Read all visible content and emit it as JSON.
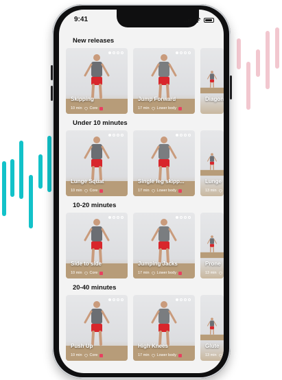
{
  "status": {
    "time": "9:41"
  },
  "colors": {
    "accent_left": "#12c2c9",
    "accent_right": "#f2c7cf",
    "level": "#e84060"
  },
  "sections": [
    {
      "title": "New releases",
      "cards": [
        {
          "name": "Skipping",
          "duration": "10 min",
          "focus": "Core",
          "dots": 4
        },
        {
          "name": "Jump Forward",
          "duration": "17 min",
          "focus": "Lower body",
          "dots": 4
        },
        {
          "name": "Diagon",
          "duration": "",
          "focus": "",
          "dots": 0
        }
      ]
    },
    {
      "title": "Under 10 minutes",
      "cards": [
        {
          "name": "Lunge Squat",
          "duration": "10 min",
          "focus": "Core",
          "dots": 4
        },
        {
          "name": "Single leg skipp...",
          "duration": "17 min",
          "focus": "Lower body",
          "dots": 4
        },
        {
          "name": "Lunge",
          "duration": "13 min",
          "focus": "",
          "dots": 0
        }
      ]
    },
    {
      "title": "10-20 minutes",
      "cards": [
        {
          "name": "Side to side",
          "duration": "10 min",
          "focus": "Core",
          "dots": 4
        },
        {
          "name": "Jumping Jacks",
          "duration": "17 min",
          "focus": "Lower body",
          "dots": 4
        },
        {
          "name": "Prone",
          "duration": "13 min",
          "focus": "",
          "dots": 0
        }
      ]
    },
    {
      "title": "20-40 minutes",
      "cards": [
        {
          "name": "Push Up",
          "duration": "10 min",
          "focus": "Core",
          "dots": 4
        },
        {
          "name": "High Knees",
          "duration": "17 min",
          "focus": "Lower body",
          "dots": 4
        },
        {
          "name": "Glute",
          "duration": "13 min",
          "focus": "",
          "dots": 0
        }
      ]
    }
  ]
}
